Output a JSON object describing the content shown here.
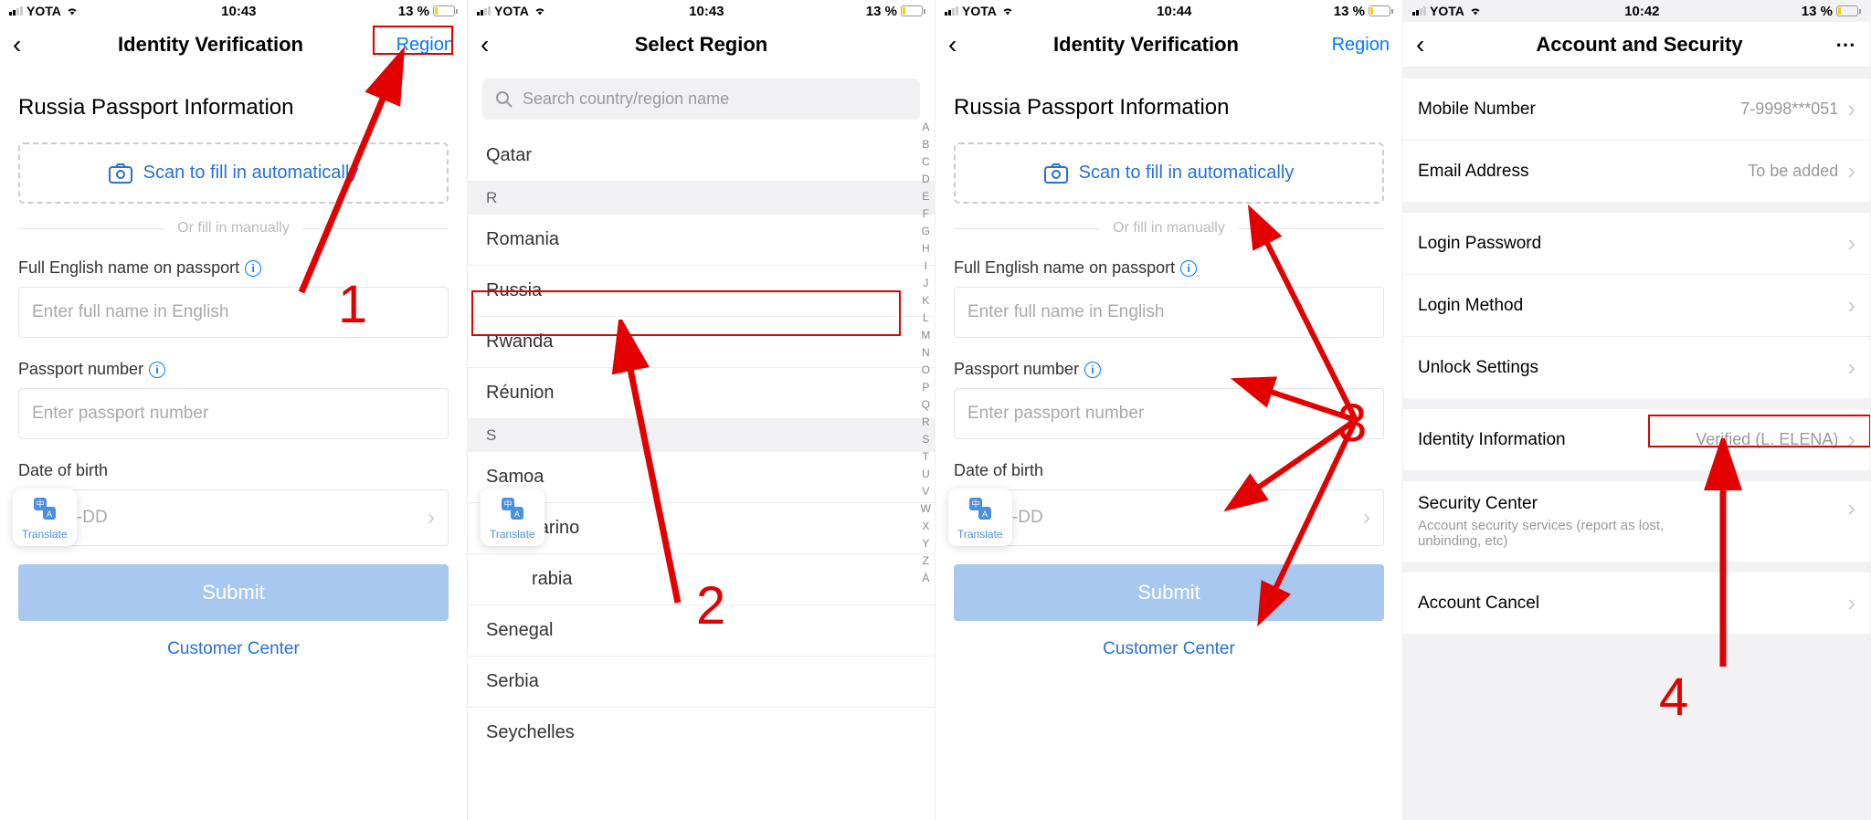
{
  "status": {
    "carrier": "YOTA",
    "time_a": "10:43",
    "time_b": "10:44",
    "time_c": "10:42",
    "battery_pct": "13 %"
  },
  "screen1": {
    "title": "Identity Verification",
    "action": "Region",
    "heading": "Russia Passport Information",
    "scan_text": "Scan to fill in automatically",
    "divider": "Or fill in manually",
    "name_label": "Full English name on passport",
    "name_placeholder": "Enter full name in English",
    "passport_label": "Passport number",
    "passport_placeholder": "Enter passport number",
    "dob_label": "Date of birth",
    "dob_placeholder": "Y-MM-DD",
    "submit": "Submit",
    "customer": "Customer Center",
    "translate": "Translate"
  },
  "screen2": {
    "title": "Select Region",
    "search_placeholder": "Search country/region name",
    "items": {
      "qatar": "Qatar",
      "sec_r": "R",
      "romania": "Romania",
      "russia": "Russia",
      "rwanda": "Rwanda",
      "reunion": "Réunion",
      "sec_s": "S",
      "samoa": "Samoa",
      "sanmarino": "San Marino",
      "arabia": "rabia",
      "senegal": "Senegal",
      "serbia": "Serbia",
      "seychelles": "Seychelles"
    },
    "index": [
      "A",
      "B",
      "C",
      "D",
      "E",
      "F",
      "G",
      "H",
      "I",
      "J",
      "K",
      "L",
      "M",
      "N",
      "O",
      "P",
      "Q",
      "R",
      "S",
      "T",
      "U",
      "V",
      "W",
      "X",
      "Y",
      "Z",
      "À"
    ]
  },
  "screen4": {
    "title": "Account and Security",
    "rows": {
      "mobile_label": "Mobile Number",
      "mobile_value": "7-9998***051",
      "email_label": "Email Address",
      "email_value": "To be added",
      "login_pw": "Login Password",
      "login_method": "Login Method",
      "unlock": "Unlock Settings",
      "identity_label": "Identity Information",
      "identity_value": "Verified (L. ELENA)",
      "security_label": "Security Center",
      "security_sub": "Account security services (report as lost, unbinding, etc)",
      "cancel": "Account Cancel"
    }
  },
  "annotations": {
    "n1": "1",
    "n2": "2",
    "n3": "3",
    "n4": "4"
  }
}
